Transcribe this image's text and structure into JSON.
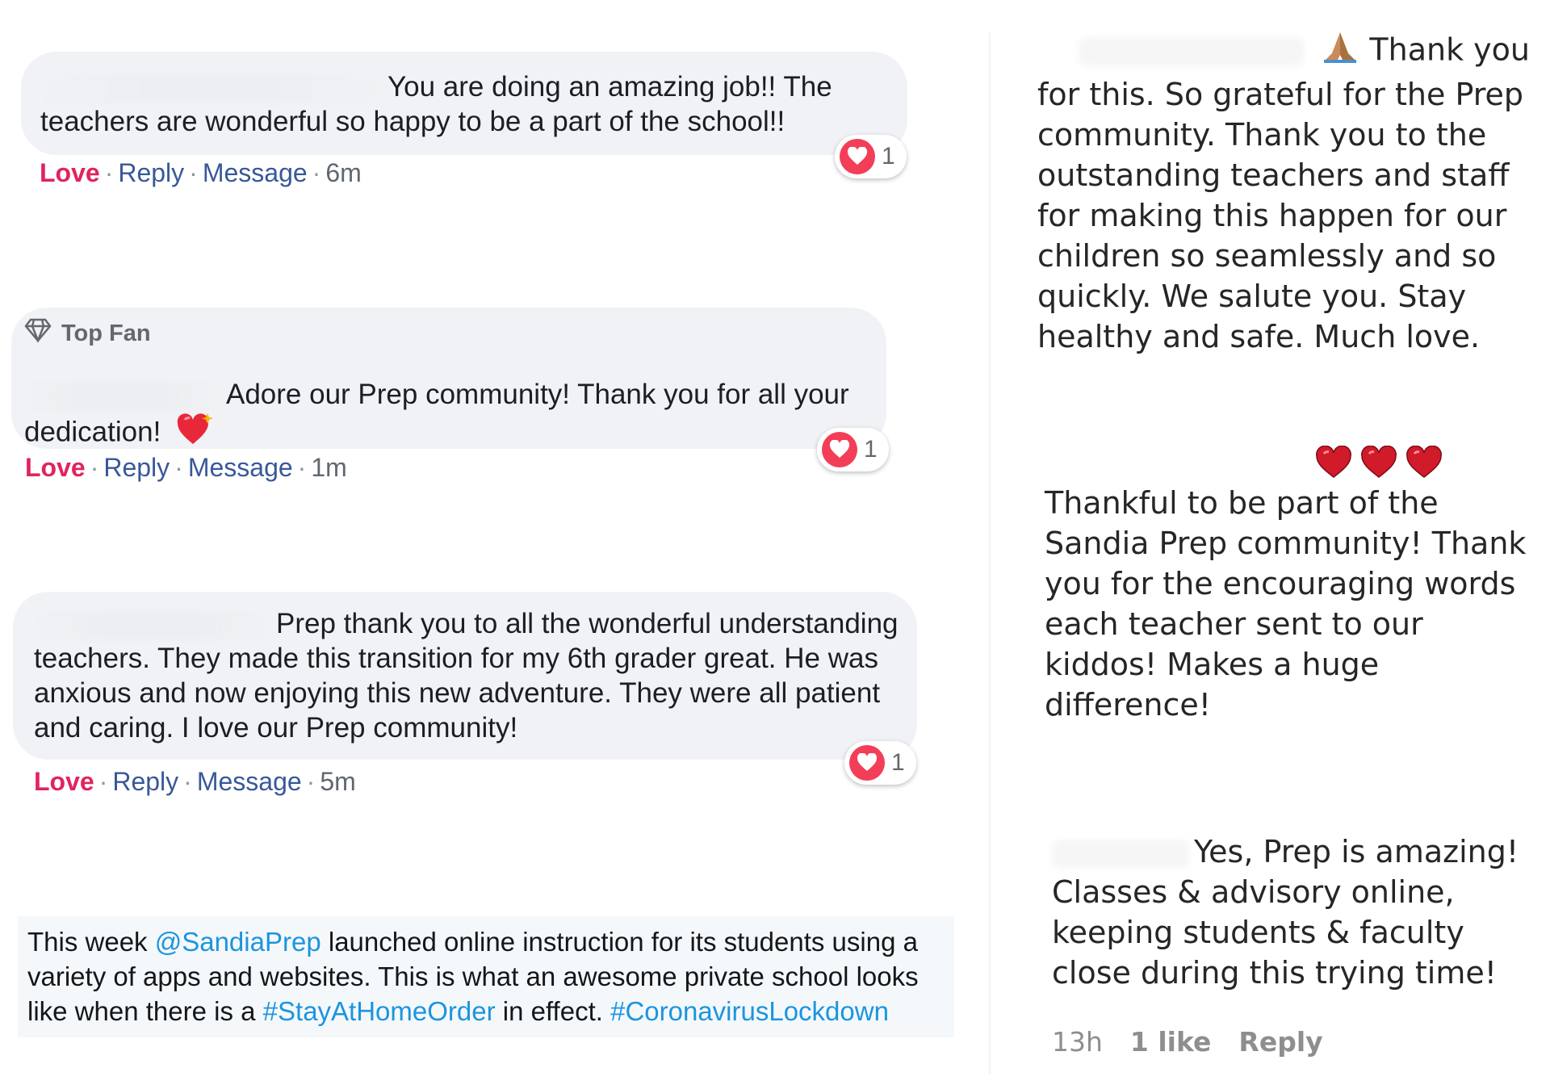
{
  "comments": [
    {
      "text": "You are doing an amazing job!! The teachers are wonderful so happy to be a part of the school!!",
      "reaction_count": "1",
      "actions": {
        "love": "Love",
        "reply": "Reply",
        "message": "Message",
        "time": "6m"
      }
    },
    {
      "badge": "Top Fan",
      "text": "Adore our Prep community! Thank you for all your dedication!",
      "reaction_count": "1",
      "actions": {
        "love": "Love",
        "reply": "Reply",
        "message": "Message",
        "time": "1m"
      }
    },
    {
      "text": "Prep thank you to all the wonderful understanding teachers. They made this transition for my 6th grader great. He was anxious and now enjoying this new adventure. They were all patient and caring. I love our Prep community!",
      "reaction_count": "1",
      "actions": {
        "love": "Love",
        "reply": "Reply",
        "message": "Message",
        "time": "5m"
      }
    }
  ],
  "tweet": {
    "part1": "This week ",
    "mention": "@SandiaPrep",
    "part2": " launched online instruction for its students using a variety of apps and websites. This is what an awesome private school looks like when there is a ",
    "hashtag1": "#StayAtHomeOrder",
    "part3": " in effect. ",
    "hashtag2": "#CoronavirusLockdown"
  },
  "ig_comments": [
    {
      "line1": "Thank you",
      "rest": "for this. So grateful for the Prep community. Thank you to the outstanding teachers and staff for making this happen for our children so seamlessly and so quickly. We salute you. Stay healthy and safe. Much love."
    },
    {
      "text": "Thankful to be part of the Sandia Prep community! Thank you for the encouraging words each teacher sent to our kiddos! Makes a huge difference!"
    },
    {
      "line1": "Yes, Prep is amazing!",
      "rest": "Classes & advisory online, keeping students & faculty close during this trying time!",
      "meta": {
        "time": "13h",
        "likes": "1 like",
        "reply": "Reply"
      }
    }
  ],
  "colors": {
    "love": "#e0245e",
    "link": "#385898",
    "twitter_link": "#1b95e0",
    "bubble": "#f0f2f5",
    "heart": "#f33e58"
  },
  "icons": [
    "heart-reaction-icon",
    "diamond-icon",
    "sparkling-heart-emoji",
    "praying-hands-emoji",
    "red-heart-emoji"
  ]
}
